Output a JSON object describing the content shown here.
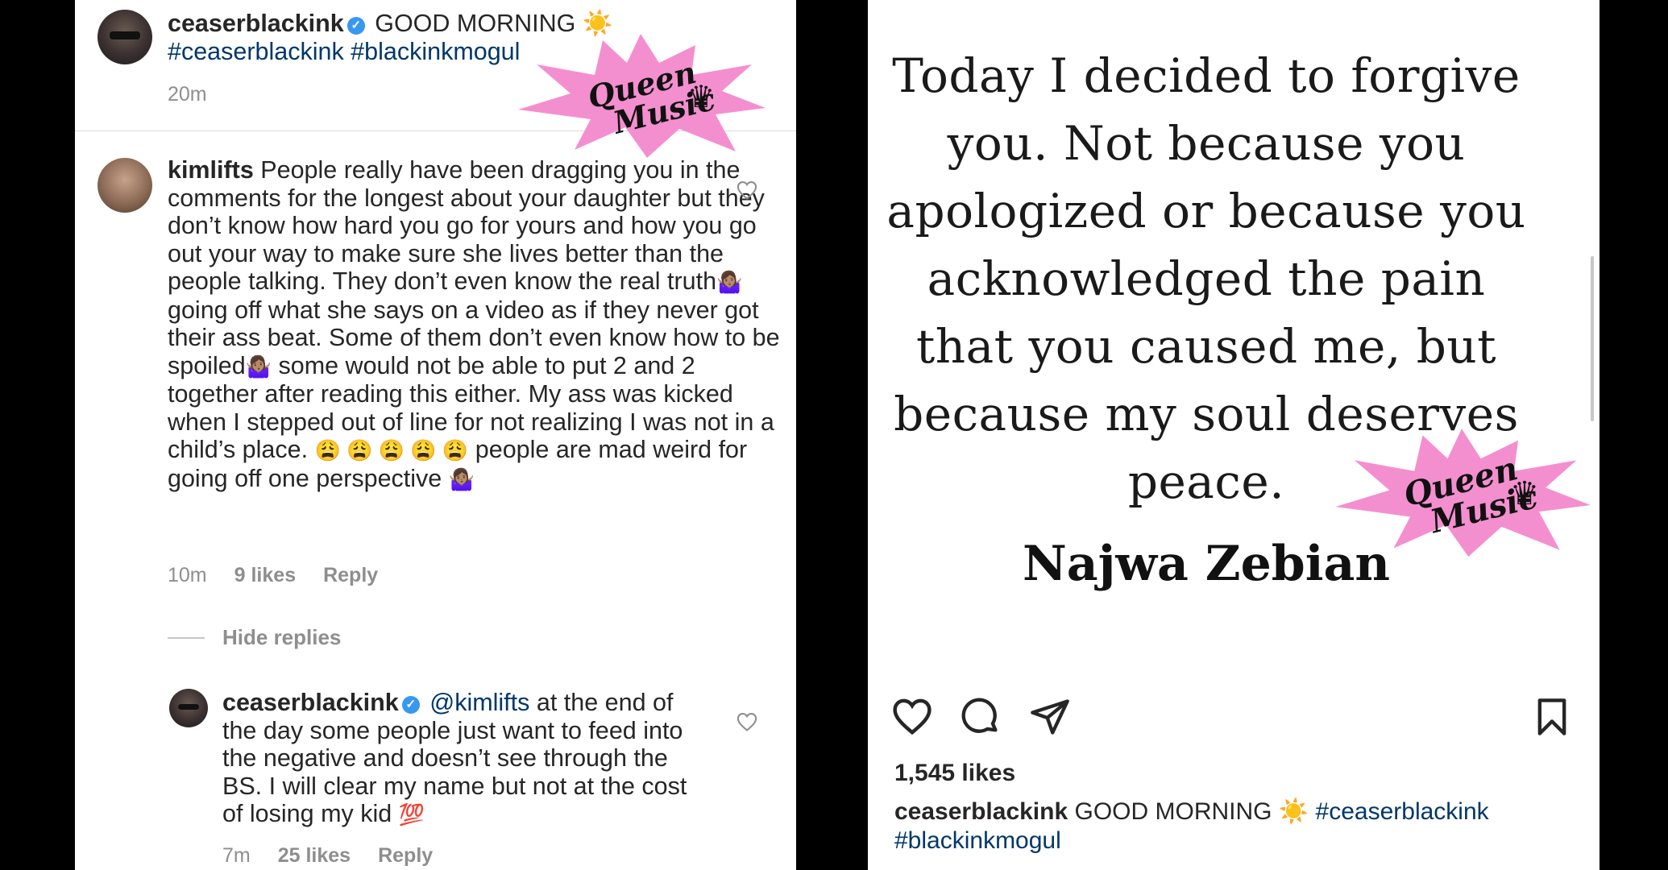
{
  "post": {
    "author": "ceaserblackink",
    "caption": "GOOD MORNING ☀️",
    "hashtags": "#ceaserblackink #blackinkmogul",
    "hashtag_1": "#ceaserblackink",
    "hashtag_2": "#blackinkmogul",
    "time": "20m",
    "likes": "1,545 likes",
    "image_quote": "Today I decided to forgive you. Not because you apologized or because you acknowledged the pain that you caused me, but because my soul deserves peace.",
    "image_author": "Najwa Zebian"
  },
  "comments": [
    {
      "username": "kimlifts",
      "text_parts": [
        "People really have been dragging you in the comments for the longest about your daughter but they don’t know how hard you go for yours and how you go out your way to make sure she lives better than the people talking. They don’t even know the real truth",
        "🤷🏽‍♀️",
        " going off what she says on a video as if they never got their ass beat. Some of them don’t even know how to be spoiled",
        "🤷🏽‍♀️",
        " some would not be able to put 2 and 2 together after reading this either. My ass was kicked when I stepped out of line for not realizing I was not in a child’s place. ",
        "😩 😩 😩 😩 😩",
        " people are mad weird for going off one perspective ",
        "🤷🏽‍♀️"
      ],
      "time": "10m",
      "likes": "9 likes",
      "reply_label": "Reply"
    },
    {
      "username": "ceaserblackink",
      "mention": "@kimlifts",
      "text_parts": [
        " at the end of the day some people just want to feed into the negative and doesn’t see through the BS. I will clear my name but not at the cost of losing my kid ",
        "💯"
      ],
      "time": "7m",
      "likes": "25 likes",
      "reply_label": "Reply"
    }
  ],
  "hide_replies_label": "Hide replies",
  "watermark": {
    "line1": "Queen",
    "line2": "Music",
    "color": "#f48fcf"
  },
  "colors": {
    "link": "#00376b",
    "verified": "#3897f0",
    "muted": "#8e8e8e"
  }
}
